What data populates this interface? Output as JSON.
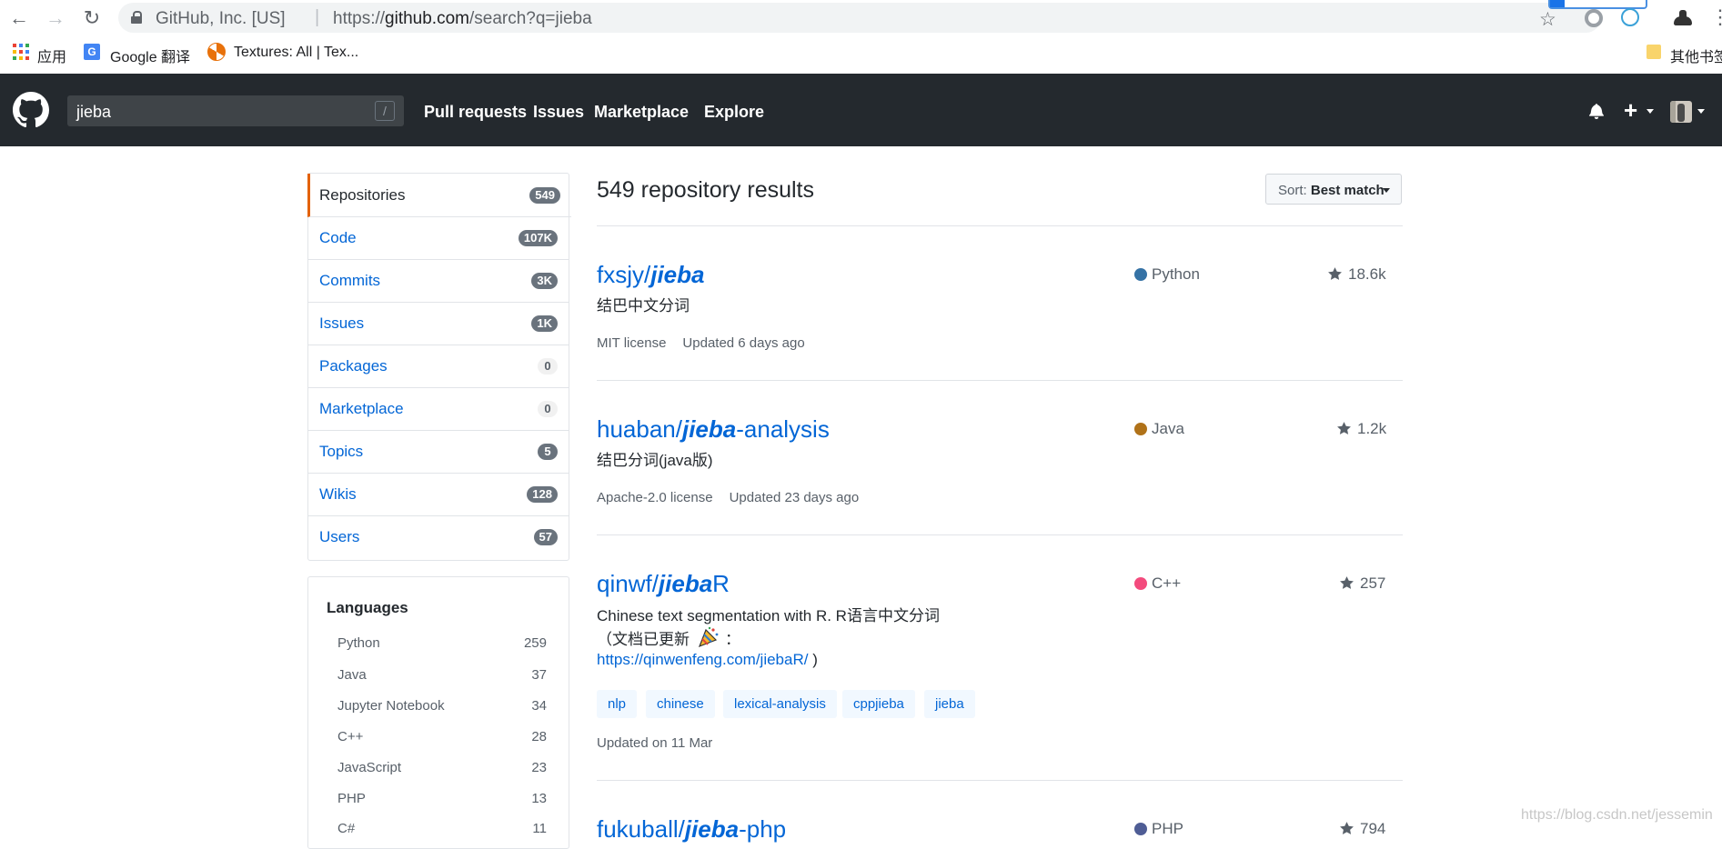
{
  "browser": {
    "site_identity": "GitHub, Inc. [US]",
    "url_scheme": "https://",
    "url_host": "github.com",
    "url_path": "/search?q=jieba",
    "bookmarks": [
      {
        "label": "应用",
        "icon": "apps-icon"
      },
      {
        "label": "Google 翻译",
        "icon": "google-translate-icon"
      },
      {
        "label": "Textures: All | Tex...",
        "icon": "textures-icon"
      },
      {
        "label": "其他书签",
        "icon": "folder-icon"
      }
    ]
  },
  "header": {
    "search_value": "jieba",
    "search_shortcut": "/",
    "nav": [
      "Pull requests",
      "Issues",
      "Marketplace",
      "Explore"
    ],
    "plus": "+"
  },
  "sidebar": {
    "items": [
      {
        "label": "Repositories",
        "count": "549",
        "selected": true
      },
      {
        "label": "Code",
        "count": "107K"
      },
      {
        "label": "Commits",
        "count": "3K"
      },
      {
        "label": "Issues",
        "count": "1K"
      },
      {
        "label": "Packages",
        "count": "0"
      },
      {
        "label": "Marketplace",
        "count": "0"
      },
      {
        "label": "Topics",
        "count": "5"
      },
      {
        "label": "Wikis",
        "count": "128"
      },
      {
        "label": "Users",
        "count": "57"
      }
    ],
    "languages_title": "Languages",
    "languages": [
      {
        "name": "Python",
        "count": "259"
      },
      {
        "name": "Java",
        "count": "37"
      },
      {
        "name": "Jupyter Notebook",
        "count": "34"
      },
      {
        "name": "C++",
        "count": "28"
      },
      {
        "name": "JavaScript",
        "count": "23"
      },
      {
        "name": "PHP",
        "count": "13"
      },
      {
        "name": "C#",
        "count": "11"
      }
    ]
  },
  "results": {
    "title": "549 repository results",
    "sort_prefix": "Sort:",
    "sort_value": "Best match",
    "repos": [
      {
        "owner": "fxsjy/",
        "name_match": "jieba",
        "name_suffix": "",
        "description": "结巴中文分词",
        "language": "Python",
        "language_color": "#3572A5",
        "stars": "18.6k",
        "license": "MIT license",
        "updated": "Updated 6 days ago"
      },
      {
        "owner": "huaban/",
        "name_match": "jieba",
        "name_suffix": "-analysis",
        "description": "结巴分词(java版)",
        "language": "Java",
        "language_color": "#b07219",
        "stars": "1.2k",
        "license": "Apache-2.0 license",
        "updated": "Updated 23 days ago"
      },
      {
        "owner": "qinwf/",
        "name_match": "jieba",
        "name_suffix": "R",
        "description": "Chinese text segmentation with R. R语言中文分词",
        "description_line2_a": "（文档已更新",
        "description_line2_b": "：",
        "link": "https://qinwenfeng.com/jiebaR/",
        "link_suffix": " )",
        "topics": [
          "nlp",
          "chinese",
          "lexical-analysis",
          "cppjieba",
          "jieba"
        ],
        "language": "C++",
        "language_color": "#f34b7d",
        "stars": "257",
        "updated": "Updated on 11 Mar"
      },
      {
        "owner": "fukuball/",
        "name_match": "jieba",
        "name_suffix": "-php",
        "language": "PHP",
        "language_color": "#4F5D95",
        "stars": "794"
      }
    ]
  },
  "watermark": "https://blog.csdn.net/jessemin"
}
